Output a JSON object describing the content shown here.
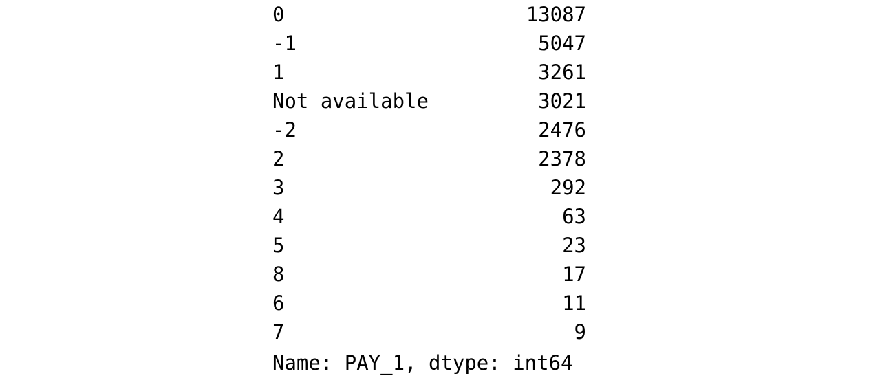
{
  "value_counts": {
    "rows": [
      {
        "index": "0",
        "value": "13087"
      },
      {
        "index": "-1",
        "value": "5047"
      },
      {
        "index": "1",
        "value": "3261"
      },
      {
        "index": "Not available",
        "value": "3021"
      },
      {
        "index": "-2",
        "value": "2476"
      },
      {
        "index": "2",
        "value": "2378"
      },
      {
        "index": "3",
        "value": "292"
      },
      {
        "index": "4",
        "value": "63"
      },
      {
        "index": "5",
        "value": "23"
      },
      {
        "index": "8",
        "value": "17"
      },
      {
        "index": "6",
        "value": "11"
      },
      {
        "index": "7",
        "value": "9"
      }
    ],
    "footer": "Name: PAY_1, dtype: int64"
  }
}
